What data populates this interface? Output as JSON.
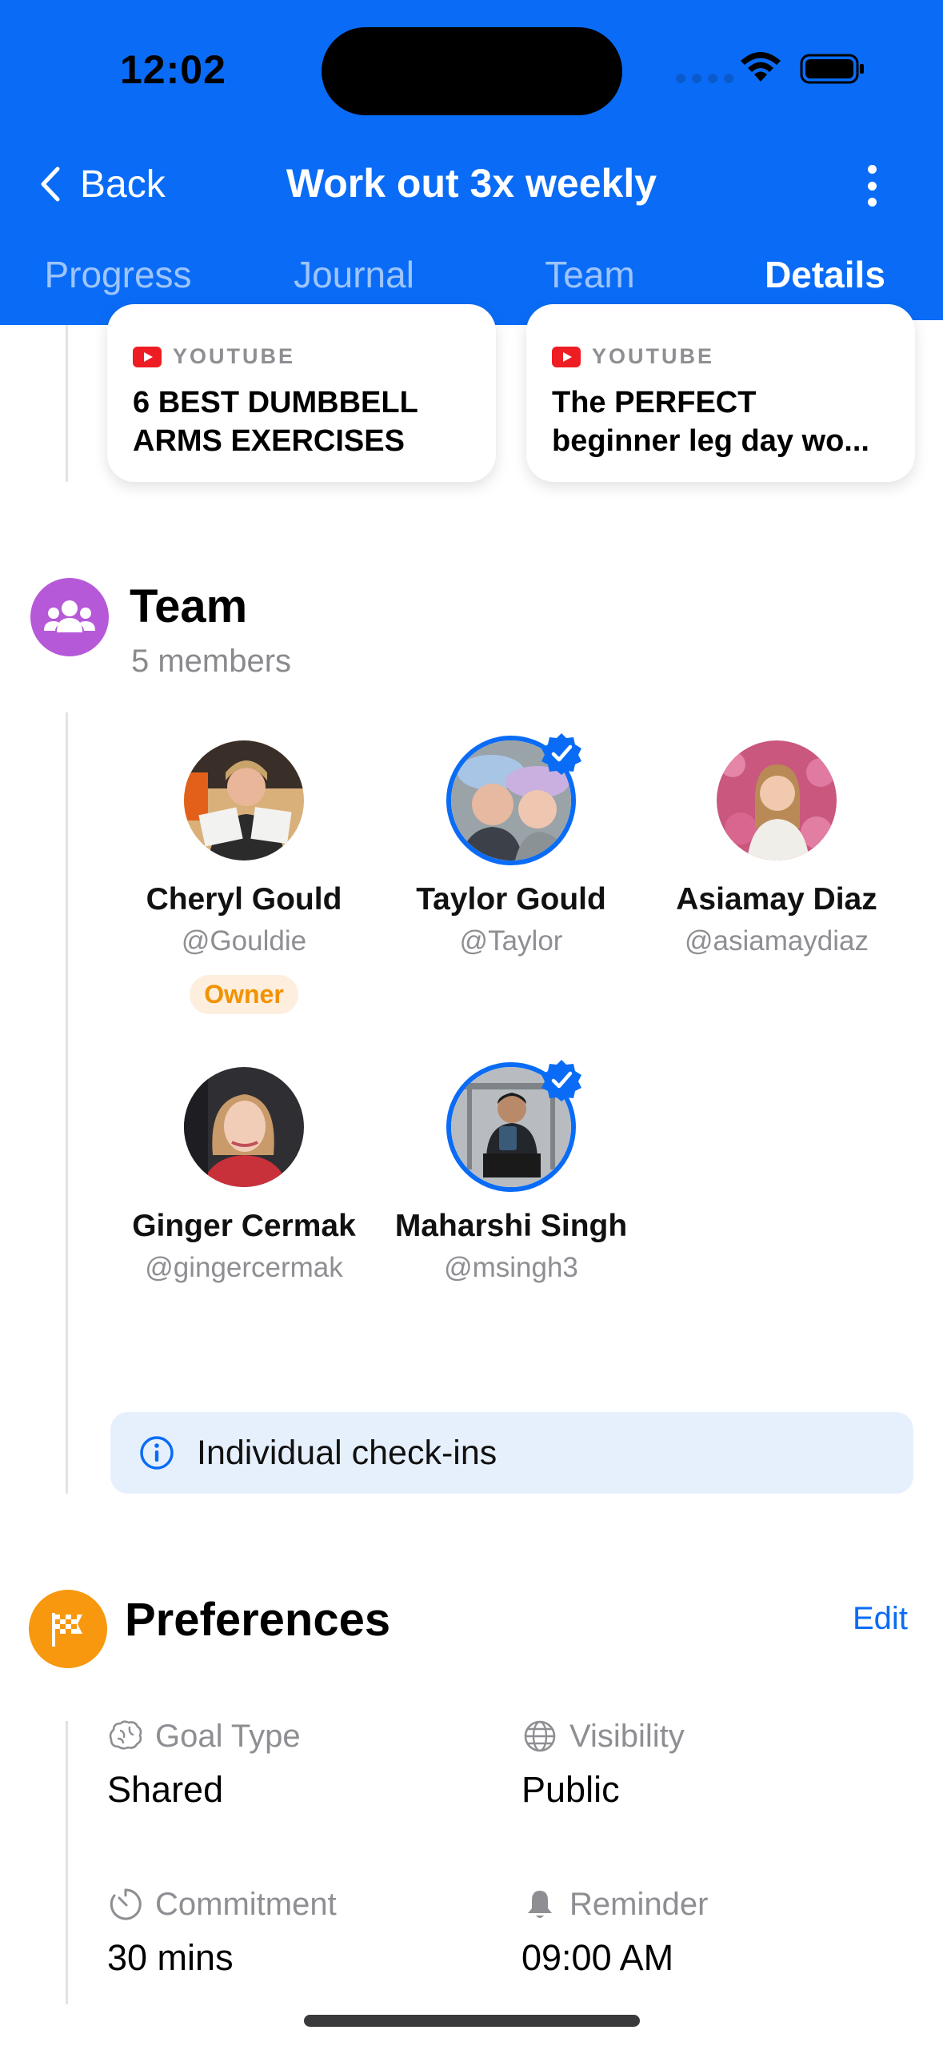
{
  "status_bar": {
    "time": "12:02"
  },
  "nav": {
    "back_label": "Back",
    "title": "Work out 3x weekly"
  },
  "tabs": [
    {
      "label": "Progress",
      "active": false
    },
    {
      "label": "Journal",
      "active": false
    },
    {
      "label": "Team",
      "active": false
    },
    {
      "label": "Details",
      "active": true
    }
  ],
  "videos": [
    {
      "source": "YOUTUBE",
      "title": "6 BEST DUMBBELL ARMS EXERCISES"
    },
    {
      "source": "YOUTUBE",
      "title": "The PERFECT beginner leg day wo..."
    }
  ],
  "team": {
    "title": "Team",
    "subtitle": "5 members",
    "members": [
      {
        "name": "Cheryl Gould",
        "handle": "@Gouldie",
        "badge": "Owner",
        "verified": false
      },
      {
        "name": "Taylor Gould",
        "handle": "@Taylor",
        "verified": true
      },
      {
        "name": "Asiamay Diaz",
        "handle": "@asiamaydiaz",
        "verified": false
      },
      {
        "name": "Ginger Cermak",
        "handle": "@gingercermak",
        "verified": false
      },
      {
        "name": "Maharshi Singh",
        "handle": "@msingh3",
        "verified": true
      }
    ],
    "info_banner": "Individual check-ins"
  },
  "preferences": {
    "title": "Preferences",
    "edit_label": "Edit",
    "items": [
      {
        "label": "Goal Type",
        "value": "Shared",
        "icon": "brain-icon"
      },
      {
        "label": "Visibility",
        "value": "Public",
        "icon": "globe-icon"
      },
      {
        "label": "Commitment",
        "value": "30 mins",
        "icon": "timer-icon"
      },
      {
        "label": "Reminder",
        "value": "09:00 AM",
        "icon": "bell-icon"
      }
    ]
  },
  "colors": {
    "accent": "#0a6cf6",
    "team_icon": "#b659d9",
    "preferences_icon": "#f7980f",
    "owner_badge_text": "#f29200",
    "owner_badge_bg": "#fdeede",
    "youtube": "#ee1d23"
  }
}
